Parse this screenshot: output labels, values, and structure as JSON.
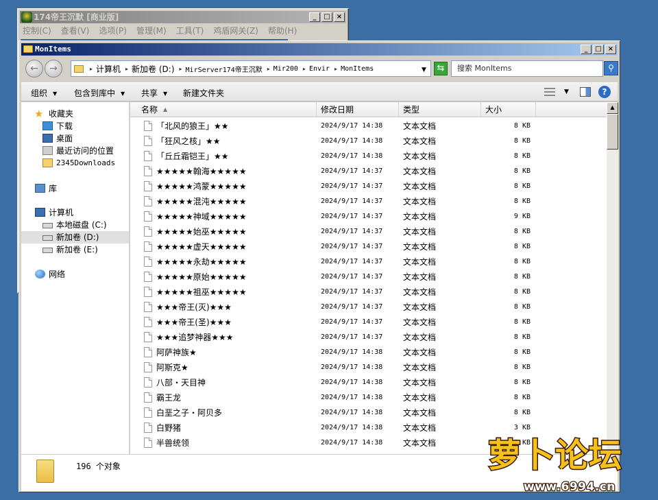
{
  "back_window": {
    "title": "174帝王沉默 [商业版]",
    "menu": [
      "控制(C)",
      "查看(V)",
      "选项(P)",
      "管理(M)",
      "工具(T)",
      "鸡盾网关(Z)",
      "帮助(H)"
    ]
  },
  "window": {
    "title": "MonItems",
    "controls": {
      "minimize": "_",
      "maximize": "□",
      "close": "×"
    }
  },
  "address": {
    "crumbs": [
      "计算机",
      "新加卷 (D:)",
      "MirServer174帝王沉默",
      "Mir200",
      "Envir",
      "MonItems"
    ],
    "search_placeholder": "搜索 MonItems"
  },
  "toolbar": {
    "organize": "组织",
    "include_library": "包含到库中",
    "share": "共享",
    "new_folder": "新建文件夹"
  },
  "nav": {
    "favorites": "收藏夹",
    "downloads": "下载",
    "desktop": "桌面",
    "recent": "最近访问的位置",
    "downloads2345": "2345Downloads",
    "libraries": "库",
    "computer": "计算机",
    "local_disk": "本地磁盘 (C:)",
    "vol_d": "新加卷 (D:)",
    "vol_e": "新加卷 (E:)",
    "network": "网络"
  },
  "columns": {
    "name": "名称",
    "date": "修改日期",
    "type": "类型",
    "size": "大小"
  },
  "files": [
    {
      "name": "「北风的狼王」★★",
      "date": "2024/9/17 14:38",
      "type": "文本文档",
      "size": "8 KB"
    },
    {
      "name": "「狂风之核」★★",
      "date": "2024/9/17 14:38",
      "type": "文本文档",
      "size": "8 KB"
    },
    {
      "name": "「丘丘霜铠王」★★",
      "date": "2024/9/17 14:38",
      "type": "文本文档",
      "size": "8 KB"
    },
    {
      "name": "★★★★★翰海★★★★★",
      "date": "2024/9/17 14:37",
      "type": "文本文档",
      "size": "8 KB"
    },
    {
      "name": "★★★★★鸿蒙★★★★★",
      "date": "2024/9/17 14:37",
      "type": "文本文档",
      "size": "8 KB"
    },
    {
      "name": "★★★★★混沌★★★★★",
      "date": "2024/9/17 14:37",
      "type": "文本文档",
      "size": "8 KB"
    },
    {
      "name": "★★★★★神域★★★★★",
      "date": "2024/9/17 14:37",
      "type": "文本文档",
      "size": "9 KB"
    },
    {
      "name": "★★★★★始巫★★★★★",
      "date": "2024/9/17 14:37",
      "type": "文本文档",
      "size": "8 KB"
    },
    {
      "name": "★★★★★虚天★★★★★",
      "date": "2024/9/17 14:37",
      "type": "文本文档",
      "size": "8 KB"
    },
    {
      "name": "★★★★★永劫★★★★★",
      "date": "2024/9/17 14:37",
      "type": "文本文档",
      "size": "8 KB"
    },
    {
      "name": "★★★★★原始★★★★★",
      "date": "2024/9/17 14:37",
      "type": "文本文档",
      "size": "8 KB"
    },
    {
      "name": "★★★★★祖巫★★★★★",
      "date": "2024/9/17 14:37",
      "type": "文本文档",
      "size": "8 KB"
    },
    {
      "name": "★★★帝王(灭)★★★",
      "date": "2024/9/17 14:37",
      "type": "文本文档",
      "size": "8 KB"
    },
    {
      "name": "★★★帝王(圣)★★★",
      "date": "2024/9/17 14:37",
      "type": "文本文档",
      "size": "8 KB"
    },
    {
      "name": "★★★追梦神器★★★",
      "date": "2024/9/17 14:37",
      "type": "文本文档",
      "size": "8 KB"
    },
    {
      "name": "阿萨神族★",
      "date": "2024/9/17 14:38",
      "type": "文本文档",
      "size": "8 KB"
    },
    {
      "name": "阿斯克★",
      "date": "2024/9/17 14:38",
      "type": "文本文档",
      "size": "8 KB"
    },
    {
      "name": "八部・天目神",
      "date": "2024/9/17 14:38",
      "type": "文本文档",
      "size": "8 KB"
    },
    {
      "name": "霸王龙",
      "date": "2024/9/17 14:38",
      "type": "文本文档",
      "size": "8 KB"
    },
    {
      "name": "白垩之子・阿贝多",
      "date": "2024/9/17 14:38",
      "type": "文本文档",
      "size": "8 KB"
    },
    {
      "name": "白野猪",
      "date": "2024/9/17 14:38",
      "type": "文本文档",
      "size": "3 KB"
    },
    {
      "name": "半兽统领",
      "date": "2024/9/17 14:38",
      "type": "文本文档",
      "size": "8 KB"
    }
  ],
  "status": {
    "count": "196 个对象"
  },
  "watermark": {
    "title": "萝卜论坛",
    "url": "www.6994.cn"
  }
}
